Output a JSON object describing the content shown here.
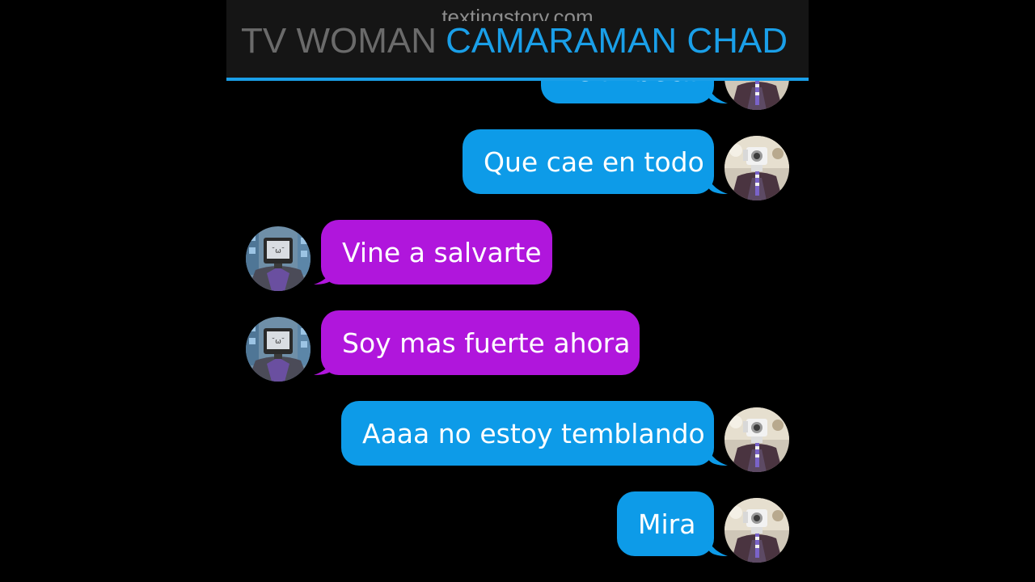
{
  "header": {
    "watermark": "textingstory.com",
    "contact_left": "TV WOMAN",
    "contact_right": "CAMARAMAN CHAD",
    "accent_color": "#1a9fe8"
  },
  "messages": [
    {
      "sender": "CAMARAMAN CHAD",
      "text": "Es imbécil",
      "color": "#0d9be8",
      "avatar": "cameraman-avatar",
      "partially_hidden": true
    },
    {
      "sender": "CAMARAMAN CHAD",
      "text": "Que cae en todo",
      "color": "#0d9be8",
      "avatar": "cameraman-avatar"
    },
    {
      "sender": "TV WOMAN",
      "text": "Vine a salvarte",
      "color": "#b016dc",
      "avatar": "tv-woman-avatar"
    },
    {
      "sender": "TV WOMAN",
      "text": "Soy mas fuerte ahora",
      "color": "#b016dc",
      "avatar": "tv-woman-avatar"
    },
    {
      "sender": "CAMARAMAN CHAD",
      "text": "Aaaa no estoy temblando",
      "color": "#0d9be8",
      "avatar": "cameraman-avatar"
    },
    {
      "sender": "CAMARAMAN CHAD",
      "text": "Mira",
      "color": "#0d9be8",
      "avatar": "cameraman-avatar"
    }
  ]
}
